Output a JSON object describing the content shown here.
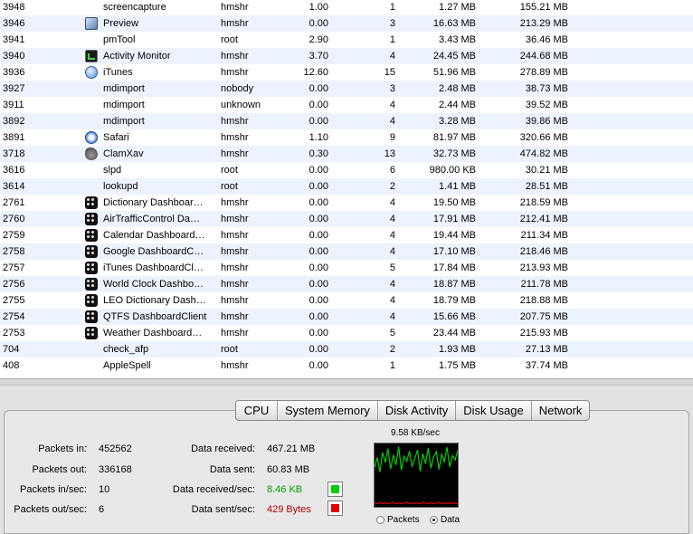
{
  "processes": [
    {
      "pid": "3948",
      "icon": "",
      "name": "screencapture",
      "user": "hmshr",
      "cpu": "1.00",
      "threads": "1",
      "real_mem": "1.27 MB",
      "virt_mem": "155.21 MB"
    },
    {
      "pid": "3946",
      "icon": "preview",
      "name": "Preview",
      "user": "hmshr",
      "cpu": "0.00",
      "threads": "3",
      "real_mem": "16.63 MB",
      "virt_mem": "213.29 MB"
    },
    {
      "pid": "3941",
      "icon": "",
      "name": "pmTool",
      "user": "root",
      "cpu": "2.90",
      "threads": "1",
      "real_mem": "3.43 MB",
      "virt_mem": "36.46 MB"
    },
    {
      "pid": "3940",
      "icon": "activity-monitor",
      "name": "Activity Monitor",
      "user": "hmshr",
      "cpu": "3.70",
      "threads": "4",
      "real_mem": "24.45 MB",
      "virt_mem": "244.68 MB"
    },
    {
      "pid": "3936",
      "icon": "itunes",
      "name": "iTunes",
      "user": "hmshr",
      "cpu": "12.60",
      "threads": "15",
      "real_mem": "51.96 MB",
      "virt_mem": "278.89 MB"
    },
    {
      "pid": "3927",
      "icon": "",
      "name": "mdimport",
      "user": "nobody",
      "cpu": "0.00",
      "threads": "3",
      "real_mem": "2.48 MB",
      "virt_mem": "38.73 MB"
    },
    {
      "pid": "3911",
      "icon": "",
      "name": "mdimport",
      "user": "unknown",
      "cpu": "0.00",
      "threads": "4",
      "real_mem": "2.44 MB",
      "virt_mem": "39.52 MB"
    },
    {
      "pid": "3892",
      "icon": "",
      "name": "mdimport",
      "user": "hmshr",
      "cpu": "0.00",
      "threads": "4",
      "real_mem": "3.28 MB",
      "virt_mem": "39.86 MB"
    },
    {
      "pid": "3891",
      "icon": "safari",
      "name": "Safari",
      "user": "hmshr",
      "cpu": "1.10",
      "threads": "9",
      "real_mem": "81.97 MB",
      "virt_mem": "320.66 MB"
    },
    {
      "pid": "3718",
      "icon": "clamxav",
      "name": "ClamXav",
      "user": "hmshr",
      "cpu": "0.30",
      "threads": "13",
      "real_mem": "32.73 MB",
      "virt_mem": "474.82 MB"
    },
    {
      "pid": "3616",
      "icon": "",
      "name": "slpd",
      "user": "root",
      "cpu": "0.00",
      "threads": "6",
      "real_mem": "980.00 KB",
      "virt_mem": "30.21 MB"
    },
    {
      "pid": "3614",
      "icon": "",
      "name": "lookupd",
      "user": "root",
      "cpu": "0.00",
      "threads": "2",
      "real_mem": "1.41 MB",
      "virt_mem": "28.51 MB"
    },
    {
      "pid": "2761",
      "icon": "dashboard",
      "name": "Dictionary Dashboar…",
      "user": "hmshr",
      "cpu": "0.00",
      "threads": "4",
      "real_mem": "19.50 MB",
      "virt_mem": "218.59 MB"
    },
    {
      "pid": "2760",
      "icon": "dashboard",
      "name": "AirTrafficControl Da…",
      "user": "hmshr",
      "cpu": "0.00",
      "threads": "4",
      "real_mem": "17.91 MB",
      "virt_mem": "212.41 MB"
    },
    {
      "pid": "2759",
      "icon": "dashboard",
      "name": "Calendar Dashboard…",
      "user": "hmshr",
      "cpu": "0.00",
      "threads": "4",
      "real_mem": "19.44 MB",
      "virt_mem": "211.34 MB"
    },
    {
      "pid": "2758",
      "icon": "dashboard",
      "name": "Google DashboardC…",
      "user": "hmshr",
      "cpu": "0.00",
      "threads": "4",
      "real_mem": "17.10 MB",
      "virt_mem": "218.46 MB"
    },
    {
      "pid": "2757",
      "icon": "dashboard",
      "name": "iTunes DashboardCl…",
      "user": "hmshr",
      "cpu": "0.00",
      "threads": "5",
      "real_mem": "17.84 MB",
      "virt_mem": "213.93 MB"
    },
    {
      "pid": "2756",
      "icon": "dashboard",
      "name": "World Clock Dashbo…",
      "user": "hmshr",
      "cpu": "0.00",
      "threads": "4",
      "real_mem": "18.87 MB",
      "virt_mem": "211.78 MB"
    },
    {
      "pid": "2755",
      "icon": "dashboard",
      "name": "LEO Dictionary Dash…",
      "user": "hmshr",
      "cpu": "0.00",
      "threads": "4",
      "real_mem": "18.79 MB",
      "virt_mem": "218.88 MB"
    },
    {
      "pid": "2754",
      "icon": "dashboard",
      "name": "QTFS DashboardClient",
      "user": "hmshr",
      "cpu": "0.00",
      "threads": "4",
      "real_mem": "15.66 MB",
      "virt_mem": "207.75 MB"
    },
    {
      "pid": "2753",
      "icon": "dashboard",
      "name": "Weather Dashboard…",
      "user": "hmshr",
      "cpu": "0.00",
      "threads": "5",
      "real_mem": "23.44 MB",
      "virt_mem": "215.93 MB"
    },
    {
      "pid": "704",
      "icon": "",
      "name": "check_afp",
      "user": "root",
      "cpu": "0.00",
      "threads": "2",
      "real_mem": "1.93 MB",
      "virt_mem": "27.13 MB"
    },
    {
      "pid": "408",
      "icon": "",
      "name": "AppleSpell",
      "user": "hmshr",
      "cpu": "0.00",
      "threads": "1",
      "real_mem": "1.75 MB",
      "virt_mem": "37.74 MB"
    }
  ],
  "tabs": [
    {
      "label": "CPU"
    },
    {
      "label": "System Memory"
    },
    {
      "label": "Disk Activity"
    },
    {
      "label": "Disk Usage"
    },
    {
      "label": "Network"
    }
  ],
  "network": {
    "packets_in_label": "Packets in:",
    "packets_in": "452562",
    "packets_out_label": "Packets out:",
    "packets_out": "336168",
    "packets_in_sec_label": "Packets in/sec:",
    "packets_in_sec": "10",
    "packets_out_sec_label": "Packets out/sec:",
    "packets_out_sec": "6",
    "data_received_label": "Data received:",
    "data_received": "467.21 MB",
    "data_sent_label": "Data sent:",
    "data_sent": "60.83 MB",
    "data_received_sec_label": "Data received/sec:",
    "data_received_sec": "8.46 KB",
    "data_sent_sec_label": "Data sent/sec:",
    "data_sent_sec": "429 Bytes",
    "received_color": "#00d000",
    "sent_color": "#e00000"
  },
  "graph": {
    "peak_label": "9.58 KB/sec",
    "received_series": [
      0.62,
      0.78,
      0.55,
      0.86,
      0.7,
      0.92,
      0.6,
      0.82,
      0.66,
      0.95,
      0.58,
      0.8,
      0.72,
      0.88,
      0.64,
      0.76,
      0.9,
      0.56,
      0.84,
      0.68,
      0.93,
      0.61,
      0.79,
      0.87,
      0.59,
      0.83,
      0.71,
      0.94,
      0.63,
      0.81,
      0.74,
      0.89
    ],
    "sent_series": [
      0.06,
      0.05,
      0.07,
      0.05,
      0.06,
      0.05,
      0.06,
      0.07,
      0.05,
      0.06,
      0.05,
      0.06,
      0.07,
      0.05,
      0.06,
      0.05,
      0.06,
      0.05,
      0.07,
      0.06,
      0.05,
      0.06,
      0.05,
      0.06,
      0.07,
      0.05,
      0.06,
      0.05,
      0.06,
      0.05,
      0.06,
      0.05
    ],
    "radio_packets": "Packets",
    "radio_data": "Data",
    "selected": "Data"
  }
}
